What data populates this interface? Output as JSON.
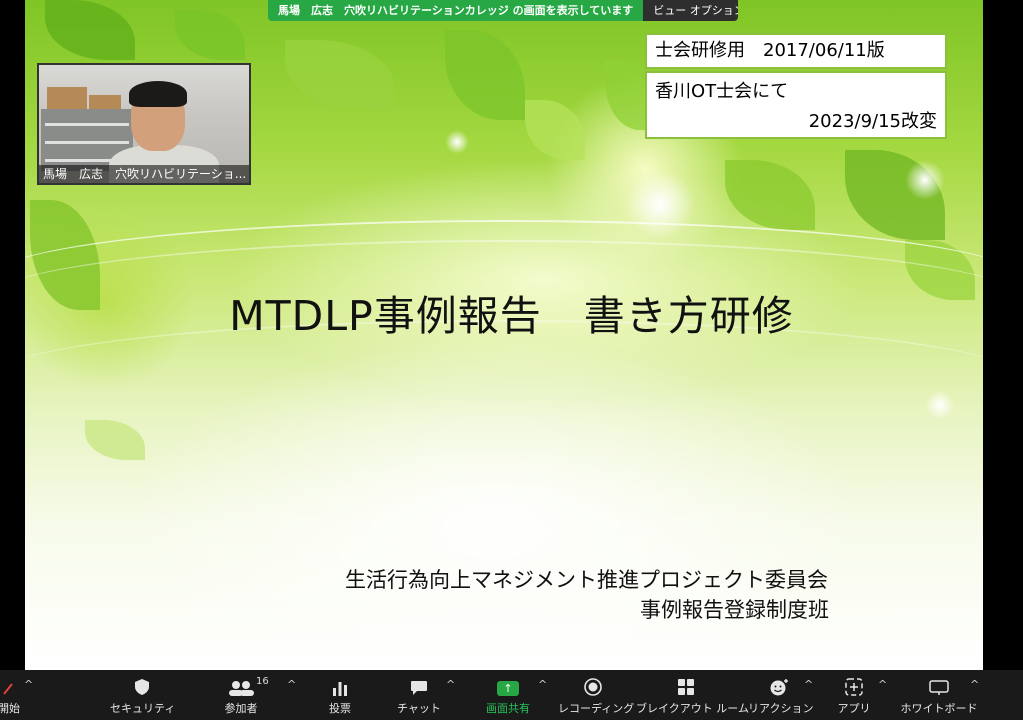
{
  "share_banner": {
    "message": "馬場　広志　穴吹リハビリテーションカレッジ の画面を表示しています",
    "view_options": "ビュー オプション"
  },
  "video": {
    "participant_name": "馬場　広志　穴吹リハビリテーショ..."
  },
  "slide": {
    "info_line_1": "士会研修用　2017/06/11版",
    "info_line_2": "香川OT士会にて",
    "info_line_3": "2023/9/15改変",
    "title": "MTDLP事例報告　書き方研修",
    "org_line_1": "生活行為向上マネジメント推進プロジェクト委員会",
    "org_line_2": "事例報告登録制度班"
  },
  "toolbar": {
    "start_label": "開始",
    "security_label": "セキュリティ",
    "participants_label": "参加者",
    "participants_count": "16",
    "polls_label": "投票",
    "chat_label": "チャット",
    "share_label": "画面共有",
    "record_label": "レコーディング",
    "breakout_label": "ブレイクアウト ルーム",
    "reactions_label": "リアクション",
    "apps_label": "アプリ",
    "whiteboard_label": "ホワイトボード"
  },
  "colors": {
    "share_green": "#27a844",
    "toolbar_bg": "#1a1a1a",
    "info_border": "#8bbf3e"
  }
}
